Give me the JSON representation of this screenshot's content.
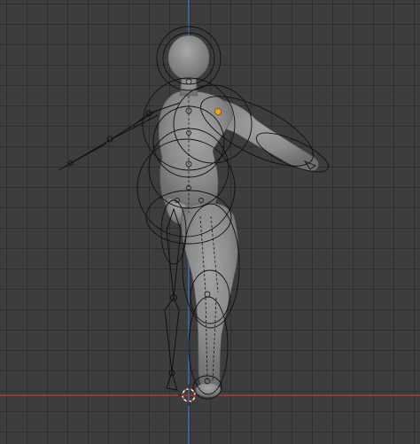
{
  "viewport": {
    "kind": "3d-viewport",
    "view": "front-orthographic",
    "content": "character-mesh-with-armature",
    "colors": {
      "background": "#3d3d3d",
      "grid": "#323232",
      "x_axis": "#a33a3a",
      "z_axis": "#3e6da6",
      "mesh": "#8f8f8f",
      "bone_wire": "#111111",
      "selected_joint": "#f1a31b",
      "cursor_red": "#d23c3c"
    },
    "icons": {
      "cursor": "3d-cursor-icon",
      "selected_bone": "bone-joint-icon"
    }
  }
}
